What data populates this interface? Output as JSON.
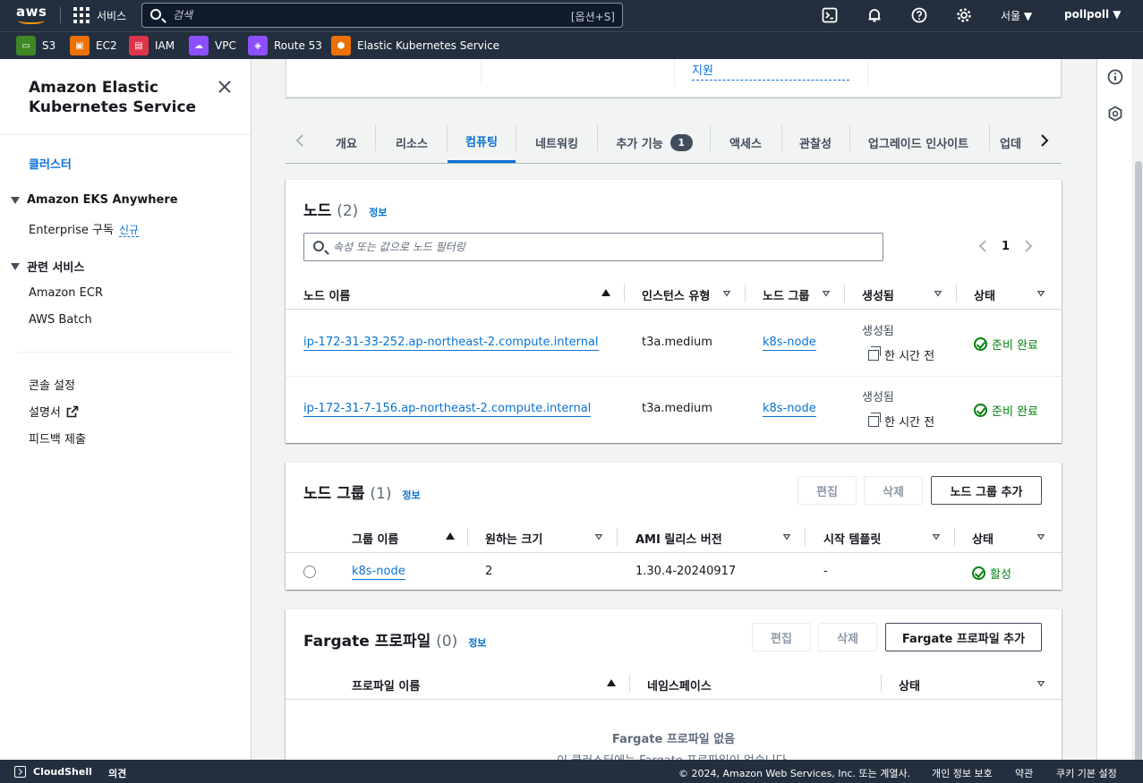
{
  "topnav": {
    "logo": "aws",
    "services_label": "서비스",
    "search_placeholder": "검색",
    "search_shortcut": "[옵션+S]",
    "region": "서울 ▼",
    "user": "pollpoll ▼",
    "icons": [
      "cloudshell-icon",
      "bell-icon",
      "help-icon",
      "gear-icon"
    ]
  },
  "favorites": [
    {
      "label": "S3",
      "color": "#3f8624"
    },
    {
      "label": "EC2",
      "color": "#ed7100"
    },
    {
      "label": "IAM",
      "color": "#dd344c"
    },
    {
      "label": "VPC",
      "color": "#8c4fff"
    },
    {
      "label": "Route 53",
      "color": "#8c4fff"
    },
    {
      "label": "Elastic Kubernetes Service",
      "color": "#ed7100"
    }
  ],
  "sidenav": {
    "title": "Amazon Elastic Kubernetes Service",
    "clusters": "클러스터",
    "section_anywhere": "Amazon EKS Anywhere",
    "enterprise": "Enterprise 구독",
    "new_badge": "신규",
    "section_related": "관련 서비스",
    "ecr": "Amazon ECR",
    "batch": "AWS Batch",
    "console_settings": "콘솔 설정",
    "docs": "설명서",
    "feedback": "피드백 제출"
  },
  "topcard": {
    "support_link": "지원"
  },
  "tabs": [
    {
      "label": "개요"
    },
    {
      "label": "리소스"
    },
    {
      "label": "컴퓨팅",
      "active": true
    },
    {
      "label": "네트워킹"
    },
    {
      "label": "추가 기능",
      "count": "1"
    },
    {
      "label": "액세스"
    },
    {
      "label": "관찰성"
    },
    {
      "label": "업그레이드 인사이트"
    },
    {
      "label": "업데"
    }
  ],
  "nodes": {
    "title": "노드",
    "count": "(2)",
    "info": "정보",
    "filter_placeholder": "속성 또는 값으로 노드 필터링",
    "page": "1",
    "columns": [
      "노드 이름",
      "인스턴스 유형",
      "노드 그룹",
      "생성됨",
      "상태"
    ],
    "rows": [
      {
        "name": "ip-172-31-33-252.ap-northeast-2.compute.internal",
        "type": "t3a.medium",
        "group": "k8s-node",
        "created_label": "생성됨",
        "created": "한 시간 전",
        "status": "준비 완료"
      },
      {
        "name": "ip-172-31-7-156.ap-northeast-2.compute.internal",
        "type": "t3a.medium",
        "group": "k8s-node",
        "created_label": "생성됨",
        "created": "한 시간 전",
        "status": "준비 완료"
      }
    ]
  },
  "nodegroups": {
    "title": "노드 그룹",
    "count": "(1)",
    "info": "정보",
    "edit": "편집",
    "delete": "삭제",
    "add": "노드 그룹 추가",
    "columns": [
      "그룹 이름",
      "원하는 크기",
      "AMI 릴리스 버전",
      "시작 템플릿",
      "상태"
    ],
    "rows": [
      {
        "name": "k8s-node",
        "size": "2",
        "ami": "1.30.4-20240917",
        "template": "-",
        "status": "활성"
      }
    ]
  },
  "fargate": {
    "title": "Fargate 프로파일",
    "count": "(0)",
    "info": "정보",
    "edit": "편집",
    "delete": "삭제",
    "add": "Fargate 프로파일 추가",
    "columns": [
      "프로파일 이름",
      "네임스페이스",
      "상태"
    ],
    "empty_title": "Fargate 프로파일 없음",
    "empty_desc": "이 클러스터에는 Fargate 프로파일이 없습니다."
  },
  "footer": {
    "cloudshell": "CloudShell",
    "feedback": "의견",
    "copyright": "© 2024, Amazon Web Services, Inc. 또는 계열사.",
    "privacy": "개인 정보 보호",
    "terms": "약관",
    "cookies": "쿠키 기본 설정"
  }
}
